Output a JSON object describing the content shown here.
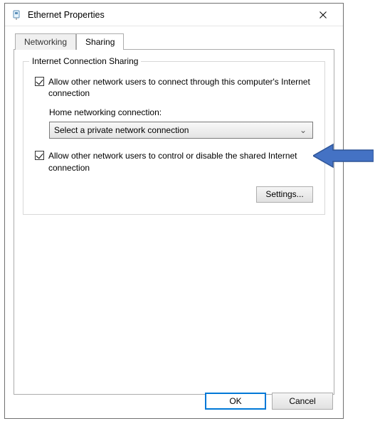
{
  "window": {
    "title": "Ethernet   Properties",
    "close_glyph": "✕"
  },
  "tabs": {
    "networking": "Networking",
    "sharing": "Sharing"
  },
  "group": {
    "title": "Internet Connection Sharing",
    "allow_connect": "Allow other network users to connect through this computer's Internet connection",
    "home_label": "Home networking connection:",
    "combo_value": "Select a private network connection",
    "chevron": "⌄",
    "allow_control": "Allow other network users to control or disable the shared Internet connection",
    "settings_btn": "Settings..."
  },
  "footer": {
    "ok": "OK",
    "cancel": "Cancel"
  }
}
